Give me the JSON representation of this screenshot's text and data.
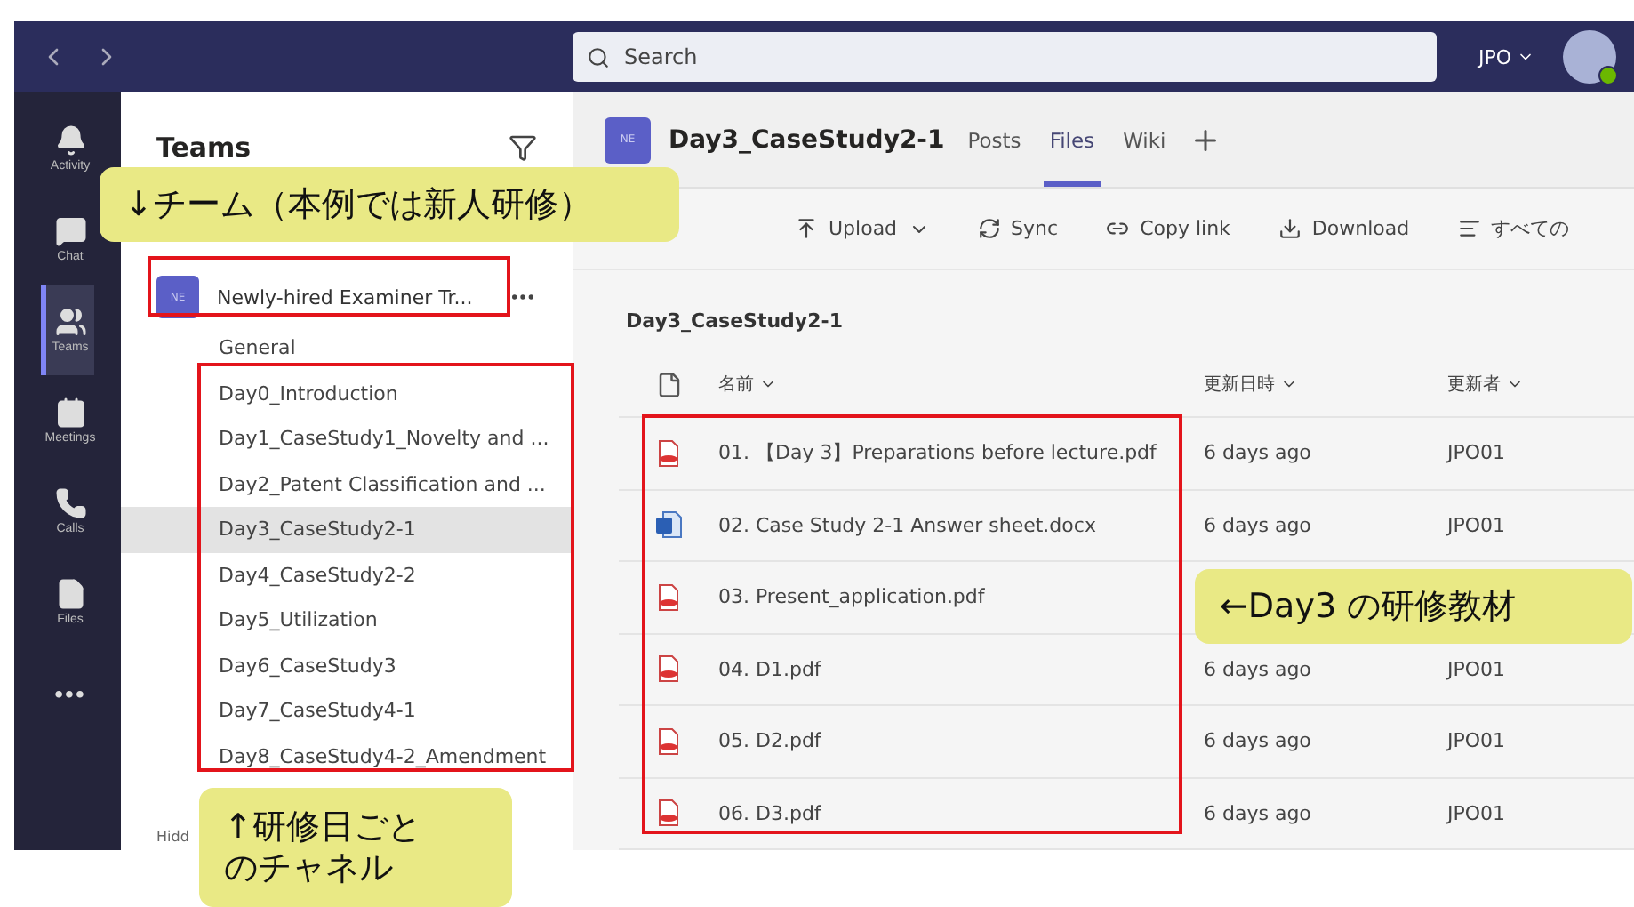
{
  "top_bar": {
    "search": {
      "placeholder": "Search"
    },
    "account": "JPO"
  },
  "rail": [
    {
      "label": "Activity",
      "kind": "bell",
      "selected": false
    },
    {
      "label": "Chat",
      "kind": "chat",
      "selected": false
    },
    {
      "label": "Teams",
      "kind": "teams",
      "selected": true
    },
    {
      "label": "Meetings",
      "kind": "calendar",
      "selected": false
    },
    {
      "label": "Calls",
      "kind": "phone",
      "selected": false
    },
    {
      "label": "Files",
      "kind": "file",
      "selected": false
    },
    {
      "label": "•••",
      "kind": "more",
      "selected": false
    }
  ],
  "sidebar": {
    "title": "Teams",
    "team": {
      "avatar": "NE",
      "name": "Newly-hired Examiner Tr..."
    },
    "channels": [
      {
        "name": "General",
        "selected": false
      },
      {
        "name": "Day0_Introduction",
        "selected": false
      },
      {
        "name": "Day1_CaseStudy1_Novelty and ...",
        "selected": false
      },
      {
        "name": "Day2_Patent Classification and ...",
        "selected": false
      },
      {
        "name": "Day3_CaseStudy2-1",
        "selected": true
      },
      {
        "name": "Day4_CaseStudy2-2",
        "selected": false
      },
      {
        "name": "Day5_Utilization",
        "selected": false
      },
      {
        "name": "Day6_CaseStudy3",
        "selected": false
      },
      {
        "name": "Day7_CaseStudy4-1",
        "selected": false
      },
      {
        "name": "Day8_CaseStudy4-2_Amendment",
        "selected": false
      }
    ],
    "footer": "Hidd"
  },
  "channel_header": {
    "avatar": "NE",
    "title": "Day3_CaseStudy2-1",
    "tabs": [
      {
        "label": "Posts",
        "selected": false
      },
      {
        "label": "Files",
        "selected": true
      },
      {
        "label": "Wiki",
        "selected": false
      }
    ]
  },
  "toolbar": [
    {
      "label": "Upload",
      "kind": "upload"
    },
    {
      "label": "Sync",
      "kind": "sync"
    },
    {
      "label": "Copy link",
      "kind": "link"
    },
    {
      "label": "Download",
      "kind": "download"
    },
    {
      "label": "すべての",
      "kind": "view"
    }
  ],
  "breadcrumb": "Day3_CaseStudy2-1",
  "table": {
    "columns": [
      "名前",
      "更新日時",
      "更新者"
    ],
    "rows": [
      {
        "kind": "pdf",
        "name": "01. 【Day 3】Preparations before lecture.pdf",
        "modified": "6 days ago",
        "by": "JPO01"
      },
      {
        "kind": "docx",
        "name": "02. Case Study 2-1 Answer sheet.docx",
        "modified": "6 days ago",
        "by": "JPO01"
      },
      {
        "kind": "pdf",
        "name": "03. Present_application.pdf"
      },
      {
        "kind": "pdf",
        "name": "04. D1.pdf",
        "modified": "6 days ago",
        "by": "JPO01"
      },
      {
        "kind": "pdf",
        "name": "05. D2.pdf",
        "modified": "6 days ago",
        "by": "JPO01"
      },
      {
        "kind": "pdf",
        "name": "06. D3.pdf",
        "modified": "6 days ago",
        "by": "JPO01"
      }
    ]
  },
  "annotations": [
    {
      "text": "↓チーム（本例では新人研修）"
    },
    {
      "text": "↑研修日ごとのチャネル"
    },
    {
      "text": "←Day3 の研修教材"
    }
  ]
}
